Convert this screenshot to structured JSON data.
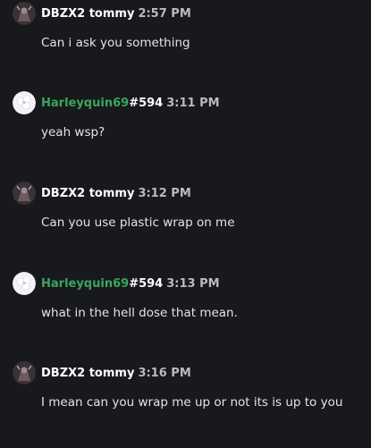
{
  "colors": {
    "background": "#18191c",
    "username_default": "#ffffff",
    "username_green": "#3ba55d",
    "timestamp": "#b9bbbe",
    "message_text": "#e3e4e6"
  },
  "messages": [
    {
      "username": "DBZX2 tommy",
      "tag": "",
      "timestamp": "2:57 PM",
      "avatar_icon": "dark-character-avatar-icon",
      "text": "Can i ask you something"
    },
    {
      "username": "Harleyquin69",
      "tag": "#594",
      "timestamp": "3:11 PM",
      "avatar_icon": "white-flower-avatar-icon",
      "text": "yeah wsp?"
    },
    {
      "username": "DBZX2 tommy",
      "tag": "",
      "timestamp": "3:12 PM",
      "avatar_icon": "dark-character-avatar-icon",
      "text": "Can you use plastic wrap on me"
    },
    {
      "username": "Harleyquin69",
      "tag": "#594",
      "timestamp": "3:13 PM",
      "avatar_icon": "white-flower-avatar-icon",
      "text": "what in the hell dose that mean."
    },
    {
      "username": "DBZX2 tommy",
      "tag": "",
      "timestamp": "3:16 PM",
      "avatar_icon": "dark-character-avatar-icon",
      "text": "I mean can you wrap me up or not its is up to you"
    }
  ]
}
